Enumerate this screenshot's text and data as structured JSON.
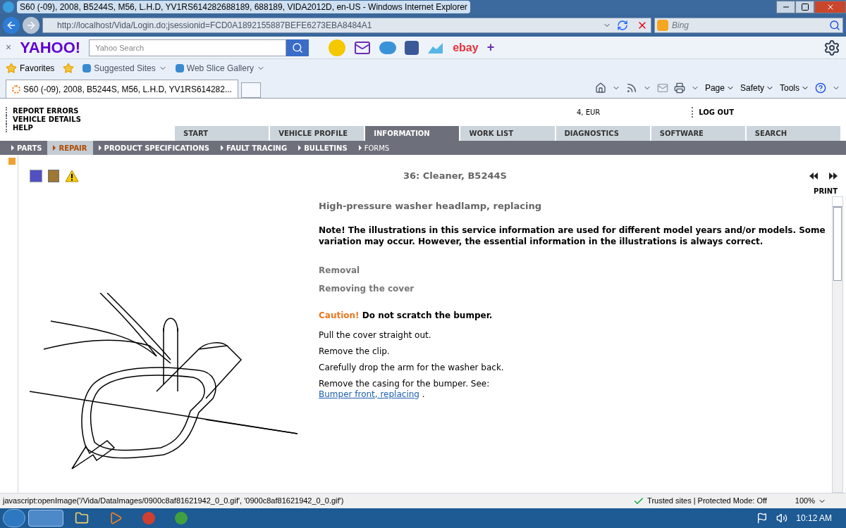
{
  "window": {
    "title": "S60 (-09), 2008, B5244S, M56, L.H.D, YV1RS614282688189, 688189, VIDA2012D, en-US - Windows Internet Explorer"
  },
  "address_bar": {
    "url": "http://localhost/Vida/Login.do;jsessionid=FCD0A1892155887BEFE6273EBA8484A1",
    "search_placeholder": "Bing"
  },
  "yahoo_toolbar": {
    "close": "×",
    "logo": "YAHOO!",
    "search_placeholder": "Yahoo Search",
    "ebay": "ebay",
    "add": "+"
  },
  "favorites_bar": {
    "label": "Favorites",
    "links": [
      "Suggested Sites",
      "Web Slice Gallery"
    ]
  },
  "browser_tabs": [
    {
      "label": "S60 (-09), 2008, B5244S, M56, L.H.D, YV1RS614282...",
      "selected": true
    }
  ],
  "command_bar": [
    "Page",
    "Safety",
    "Tools"
  ],
  "app": {
    "links": [
      "REPORT ERRORS",
      "VEHICLE DETAILS",
      "HELP"
    ],
    "currency": "4, EUR",
    "logout": "LOG OUT"
  },
  "main_tabs": [
    {
      "label": "START",
      "selected": false
    },
    {
      "label": "VEHICLE PROFILE",
      "selected": false
    },
    {
      "label": "INFORMATION",
      "selected": true
    },
    {
      "label": "WORK LIST",
      "selected": false
    },
    {
      "label": "DIAGNOSTICS",
      "selected": false
    },
    {
      "label": "SOFTWARE",
      "selected": false
    },
    {
      "label": "SEARCH",
      "selected": false
    }
  ],
  "sub_tabs": [
    {
      "label": "PARTS",
      "selected": false,
      "disabled": false
    },
    {
      "label": "REPAIR",
      "selected": true,
      "disabled": false
    },
    {
      "label": "PRODUCT SPECIFICATIONS",
      "selected": false,
      "disabled": false
    },
    {
      "label": "FAULT TRACING",
      "selected": false,
      "disabled": false
    },
    {
      "label": "BULLETINS",
      "selected": false,
      "disabled": false
    },
    {
      "label": "FORMS",
      "selected": false,
      "disabled": true
    }
  ],
  "document": {
    "heading": "36: Cleaner, B5244S",
    "print": "PRINT",
    "title": "High-pressure washer headlamp, replacing",
    "note": "Note! The illustrations in this service information are used for different model years and/or models. Some variation may occur. However, the essential information in the illustrations is always correct.",
    "sections": [
      "Removal",
      "Removing the cover"
    ],
    "caution_label": "Caution!",
    "caution_text": "Do not scratch the bumper.",
    "steps": [
      {
        "text": "Pull the cover straight out."
      },
      {
        "text": "Remove the clip."
      },
      {
        "text": "Carefully drop the arm for the washer back."
      },
      {
        "text": "Remove the casing for the bumper. See: ",
        "link": "Bumper front, replacing",
        "suffix": " ."
      }
    ]
  },
  "status_bar": {
    "text": "javascript:openImage('/Vida/DataImages/0900c8af81621942_0_0.gif', '0900c8af81621942_0_0.gif')",
    "zone": "Trusted sites | Protected Mode: Off",
    "zoom": "100%"
  },
  "taskbar": {
    "time": "10:12 AM"
  }
}
